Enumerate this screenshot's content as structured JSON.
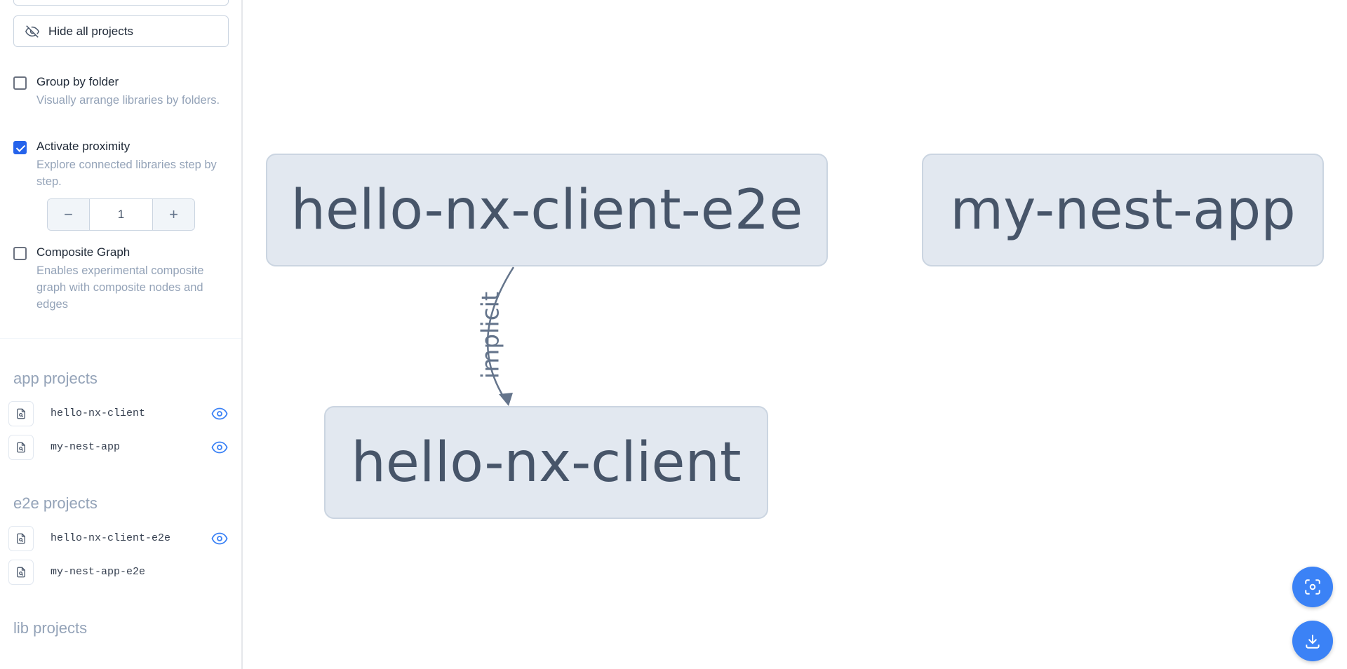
{
  "sidebar": {
    "hide_all_label": "Hide all projects",
    "options": {
      "group_by_folder": {
        "title": "Group by folder",
        "desc": "Visually arrange libraries by folders.",
        "checked": false
      },
      "proximity": {
        "title": "Activate proximity",
        "desc": "Explore connected libraries step by step.",
        "checked": true
      },
      "composite": {
        "title": "Composite Graph",
        "desc": "Enables experimental composite graph with composite nodes and edges",
        "checked": false
      }
    },
    "stepper": {
      "minus": "−",
      "value": "1",
      "plus": "+"
    },
    "groups": {
      "app": {
        "title": "app projects",
        "items": [
          "hello-nx-client",
          "my-nest-app"
        ]
      },
      "e2e": {
        "title": "e2e projects",
        "items": [
          "hello-nx-client-e2e",
          "my-nest-app-e2e"
        ]
      },
      "lib": {
        "title": "lib projects"
      }
    }
  },
  "graph": {
    "nodes": {
      "e2e": "hello-nx-client-e2e",
      "nest": "my-nest-app",
      "client": "hello-nx-client"
    },
    "edge_label": "implicit"
  },
  "colors": {
    "accent": "#3b82f6",
    "node_bg": "#e2e8f0",
    "node_text": "#475569"
  },
  "icons": {
    "hide": "eye-off-icon",
    "project": "file-search-icon",
    "visible": "eye-icon",
    "focus": "focus-icon",
    "download": "download-icon"
  }
}
